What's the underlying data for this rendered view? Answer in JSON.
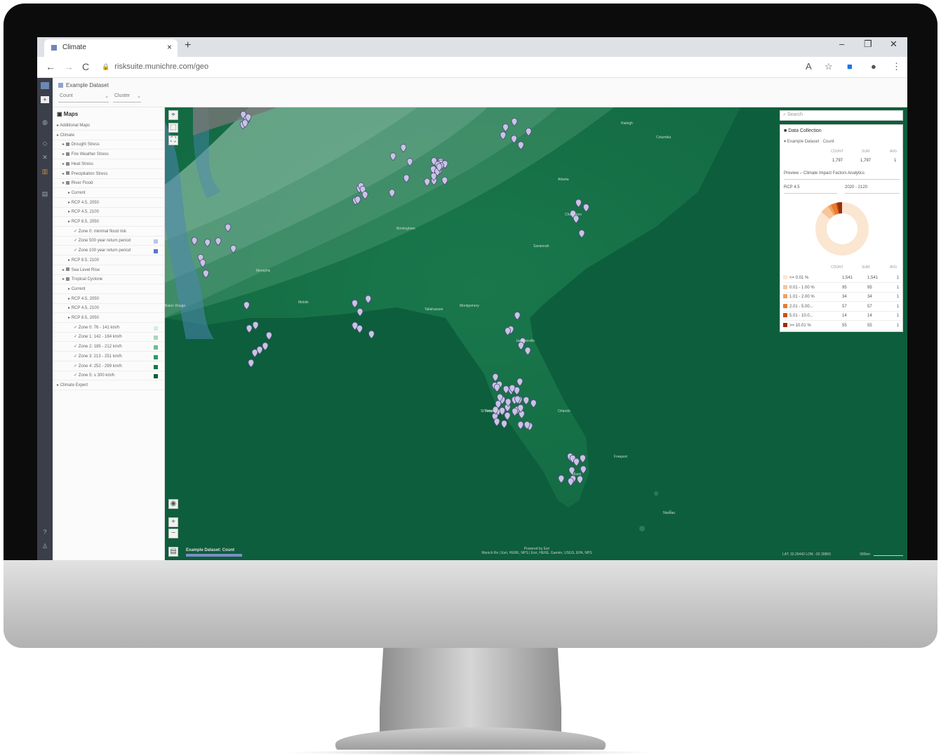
{
  "browser": {
    "tab_title": "Climate",
    "tab_close": "×",
    "new_tab": "+",
    "url": "risksuite.munichre.com/geo",
    "back": "←",
    "forward": "→",
    "reload": "C",
    "lock": "🔒",
    "minimize": "–",
    "restore": "❐",
    "close": "✕",
    "translate_icon": "A",
    "star_icon": "☆",
    "extension_icon": "■",
    "profile_icon": "●",
    "menu_icon": "⋮"
  },
  "dataset": {
    "name": "Example Dataset",
    "metric": "Count",
    "mode": "Cluster"
  },
  "sidebar": {
    "title": "Maps",
    "items": [
      {
        "label": "Additional Maps",
        "indent": 0
      },
      {
        "label": "Climate",
        "indent": 0
      },
      {
        "label": "Drought Stress",
        "indent": 1
      },
      {
        "label": "Fire Weather Stress",
        "indent": 1
      },
      {
        "label": "Heat Stress",
        "indent": 1
      },
      {
        "label": "Precipitation Stress",
        "indent": 1
      },
      {
        "label": "River Flood",
        "indent": 1
      },
      {
        "label": "Current",
        "indent": 2
      },
      {
        "label": "RCP 4.5, 2050",
        "indent": 2
      },
      {
        "label": "RCP 4.5, 2100",
        "indent": 2
      },
      {
        "label": "RCP 8.5, 2050",
        "indent": 2
      },
      {
        "label": "Zone 0: minimal flood risk",
        "indent": 3
      },
      {
        "label": "Zone 500 year return period",
        "indent": 3,
        "color": "#b9c7e6"
      },
      {
        "label": "Zone 100 year return period",
        "indent": 3,
        "color": "#5a78c8"
      },
      {
        "label": "RCP 8.5, 2100",
        "indent": 2
      },
      {
        "label": "Sea Level Rise",
        "indent": 1
      },
      {
        "label": "Tropical Cyclone",
        "indent": 1
      },
      {
        "label": "Current",
        "indent": 2
      },
      {
        "label": "RCP 4.5, 2050",
        "indent": 2
      },
      {
        "label": "RCP 4.5, 2100",
        "indent": 2
      },
      {
        "label": "RCP 8.5, 2050",
        "indent": 2
      },
      {
        "label": "Zone 0: 76 - 141 km/h",
        "indent": 3,
        "color": "#d7ece2"
      },
      {
        "label": "Zone 1: 142 - 184 km/h",
        "indent": 3,
        "color": "#a9d5bf"
      },
      {
        "label": "Zone 2: 185 - 212 km/h",
        "indent": 3,
        "color": "#6dbb93"
      },
      {
        "label": "Zone 3: 213 - 251 km/h",
        "indent": 3,
        "color": "#2f9a66"
      },
      {
        "label": "Zone 4: 252 - 299 km/h",
        "indent": 3,
        "color": "#137a48"
      },
      {
        "label": "Zone 5: ≥ 300 km/h",
        "indent": 3,
        "color": "#0b5e37"
      },
      {
        "label": "Climate Expert",
        "indent": 0
      }
    ]
  },
  "map": {
    "cities": [
      {
        "name": "Memphis"
      },
      {
        "name": "Atlanta"
      },
      {
        "name": "Birmingham"
      },
      {
        "name": "Montgomery"
      },
      {
        "name": "Mobile"
      },
      {
        "name": "Tallahassee"
      },
      {
        "name": "Jacksonville"
      },
      {
        "name": "Orlando"
      },
      {
        "name": "Tampa"
      },
      {
        "name": "St Petersburg"
      },
      {
        "name": "Miami"
      },
      {
        "name": "Savannah"
      },
      {
        "name": "Charleston"
      },
      {
        "name": "Raleigh"
      },
      {
        "name": "Columbia"
      },
      {
        "name": "Baton Rouge"
      },
      {
        "name": "Nassau"
      },
      {
        "name": "Freeport"
      }
    ],
    "legend_title": "Example Dataset: Count",
    "powered_by": "Powered by Esri",
    "attribution": "Munich Re | Esri, HERE, NPS | Esri, HERE, Garmin, USGS, EPA, NPS",
    "coords": "LAT: 33.26442   LON: -92.30860",
    "scale_label": "300km",
    "zoom_in": "+",
    "zoom_out": "−"
  },
  "panel": {
    "search_placeholder": "Search",
    "title": "Data Collection",
    "dataset_label": "Example Dataset · Count",
    "columns": [
      "COUNT",
      "SUM",
      "AVG"
    ],
    "totals": [
      "1,797",
      "1,797",
      "1"
    ],
    "preview_label": "Preview – Climate Impact Factors Analytics",
    "scenario": "RCP 4.5",
    "period": "2020 - 2120",
    "legend_columns": [
      "COUNT",
      "SUM",
      "AVG"
    ],
    "legend_rows": [
      {
        "label": "<= 0.01 %",
        "count": "1,541",
        "sum": "1,541",
        "avg": "1",
        "color": "#fbe6d2"
      },
      {
        "label": "0.01 - 1.00 %",
        "count": "95",
        "sum": "95",
        "avg": "1",
        "color": "#f8c59b"
      },
      {
        "label": "1.01 - 2.00 %",
        "count": "34",
        "sum": "34",
        "avg": "1",
        "color": "#f2a15f"
      },
      {
        "label": "2.01 - 5.00...",
        "count": "57",
        "sum": "57",
        "avg": "1",
        "color": "#e87d2e"
      },
      {
        "label": "5.01 - 10.0...",
        "count": "14",
        "sum": "14",
        "avg": "1",
        "color": "#cf4f11"
      },
      {
        "label": ">= 10.01 %",
        "count": "55",
        "sum": "55",
        "avg": "1",
        "color": "#9f2d06"
      }
    ]
  }
}
